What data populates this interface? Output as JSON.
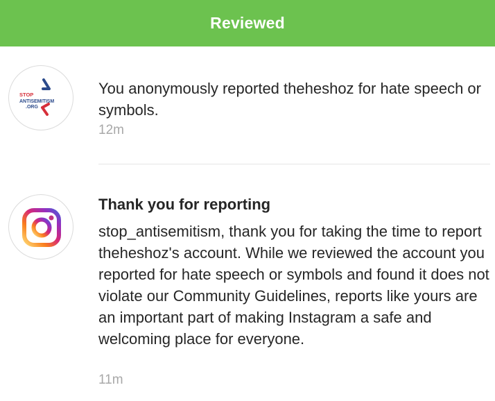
{
  "header": {
    "status": "Reviewed",
    "color": "#6cc24f"
  },
  "notifications": [
    {
      "avatar_logo": {
        "line1": "STOP",
        "line2": "ANTISEMITISM",
        "line3": ".ORG"
      },
      "text": "You anonymously reported theheshoz for hate speech or symbols.",
      "time": "12m"
    },
    {
      "avatar_icon": "instagram-logo-icon",
      "title": "Thank you for reporting",
      "text": "stop_antisemitism, thank you for taking the time to report theheshoz's account. While we reviewed the account you reported for hate speech or symbols and found it does not violate our Community Guidelines, reports like yours are an important part of making Instagram a safe and welcoming place for everyone.",
      "time": "11m"
    }
  ]
}
